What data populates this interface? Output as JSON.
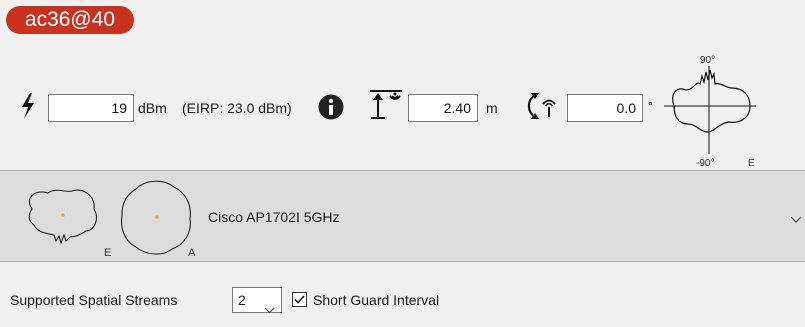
{
  "band": {
    "label": "ac36@40"
  },
  "power": {
    "icon": "lightning-icon",
    "value": "19",
    "unit": "dBm",
    "eirp": "(EIRP: 23.0 dBm)",
    "info_icon": "info-icon"
  },
  "height": {
    "icon": "antenna-height-icon",
    "value": "2.40",
    "unit": "m"
  },
  "rotation": {
    "icon": "rotate-antenna-icon",
    "value": "0.0",
    "unit": "°"
  },
  "elevation_plot": {
    "top_label": "90°",
    "bottom_label": "-90°",
    "side_label": "E"
  },
  "antenna": {
    "name": "Cisco AP1702I 5GHz",
    "pattern_e_label": "E",
    "pattern_a_label": "A",
    "dropdown_icon": "chevron-down-icon"
  },
  "streams": {
    "label": "Supported Spatial Streams",
    "value": "2",
    "dropdown_icon": "chevron-down-icon"
  },
  "guard": {
    "label": "Short Guard Interval",
    "checked": true
  },
  "colors": {
    "badge": "#c8321f",
    "band_bg": "#dcdcdc",
    "pattern_center": "#f0a030"
  }
}
